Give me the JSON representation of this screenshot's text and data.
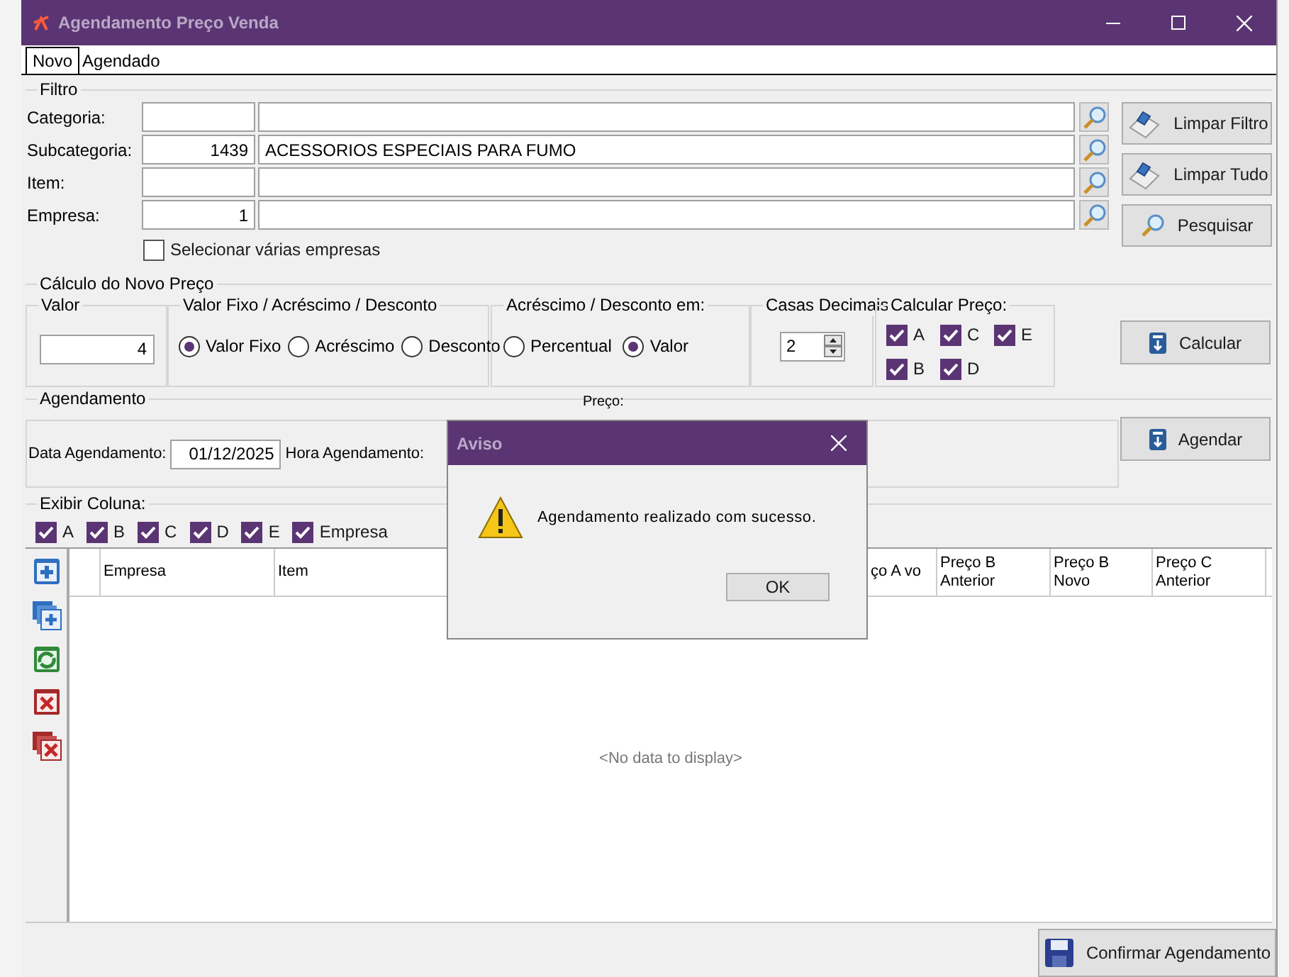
{
  "window": {
    "title": "Agendamento Preço Venda"
  },
  "tabs": [
    {
      "label": "Novo",
      "selected": true
    },
    {
      "label": "Agendado",
      "selected": false
    }
  ],
  "filter": {
    "title": "Filtro",
    "rows": [
      {
        "label": "Categoria:",
        "code": "",
        "description": ""
      },
      {
        "label": "Subcategoria:",
        "code": "1439",
        "description": "ACESSORIOS ESPECIAIS PARA FUMO"
      },
      {
        "label": "Item:",
        "code": "",
        "description": ""
      },
      {
        "label": "Empresa:",
        "code": "1",
        "description": ""
      }
    ],
    "multi": {
      "label": "Selecionar várias empresas",
      "checked": false
    },
    "buttons": [
      {
        "label": "Limpar Filtro",
        "kind": "eraser"
      },
      {
        "label": "Limpar Tudo",
        "kind": "eraser"
      },
      {
        "label": "Pesquisar",
        "kind": "search"
      }
    ]
  },
  "calc": {
    "title": "Cálculo do Novo Preço",
    "valor": {
      "title": "Valor",
      "value": "4"
    },
    "tipo": {
      "title": "Valor Fixo / Acréscimo / Desconto",
      "options": [
        {
          "label": "Valor Fixo",
          "selected": true
        },
        {
          "label": "Acréscimo",
          "selected": false
        },
        {
          "label": "Desconto",
          "selected": false
        }
      ]
    },
    "modo": {
      "title": "Acréscimo / Desconto em:",
      "options": [
        {
          "label": "Percentual",
          "selected": false
        },
        {
          "label": "Valor",
          "selected": true
        }
      ]
    },
    "casas": {
      "title": "Casas Decimais",
      "value": "2"
    },
    "precos": {
      "title": "Calcular Preço:",
      "options": [
        {
          "label": "A",
          "checked": true
        },
        {
          "label": "C",
          "checked": true
        },
        {
          "label": "E",
          "checked": true
        },
        {
          "label": "B",
          "checked": true
        },
        {
          "label": "D",
          "checked": true
        }
      ]
    },
    "button": "Calcular"
  },
  "agendamento": {
    "title": "Agendamento",
    "date_label": "Data Agendamento:",
    "date": "01/12/2025",
    "hour_label": "Hora Agendamento:",
    "price_label": "Preço:",
    "button": "Agendar"
  },
  "columns_filter": {
    "title": "Exibir Coluna:",
    "options": [
      {
        "label": "A",
        "checked": true
      },
      {
        "label": "B",
        "checked": true
      },
      {
        "label": "C",
        "checked": true
      },
      {
        "label": "D",
        "checked": true
      },
      {
        "label": "E",
        "checked": true
      },
      {
        "label": "Empresa",
        "checked": true
      }
    ]
  },
  "grid": {
    "columns": [
      "Empresa",
      "Item",
      "ço A vo",
      "Preço B Anterior",
      "Preço B Novo",
      "Preço C Anterior"
    ],
    "empty_text": "<No data to display>"
  },
  "footer": {
    "button": "Confirmar Agendamento"
  },
  "dialog": {
    "title": "Aviso",
    "message": "Agendamento realizado com sucesso.",
    "button": "OK"
  }
}
